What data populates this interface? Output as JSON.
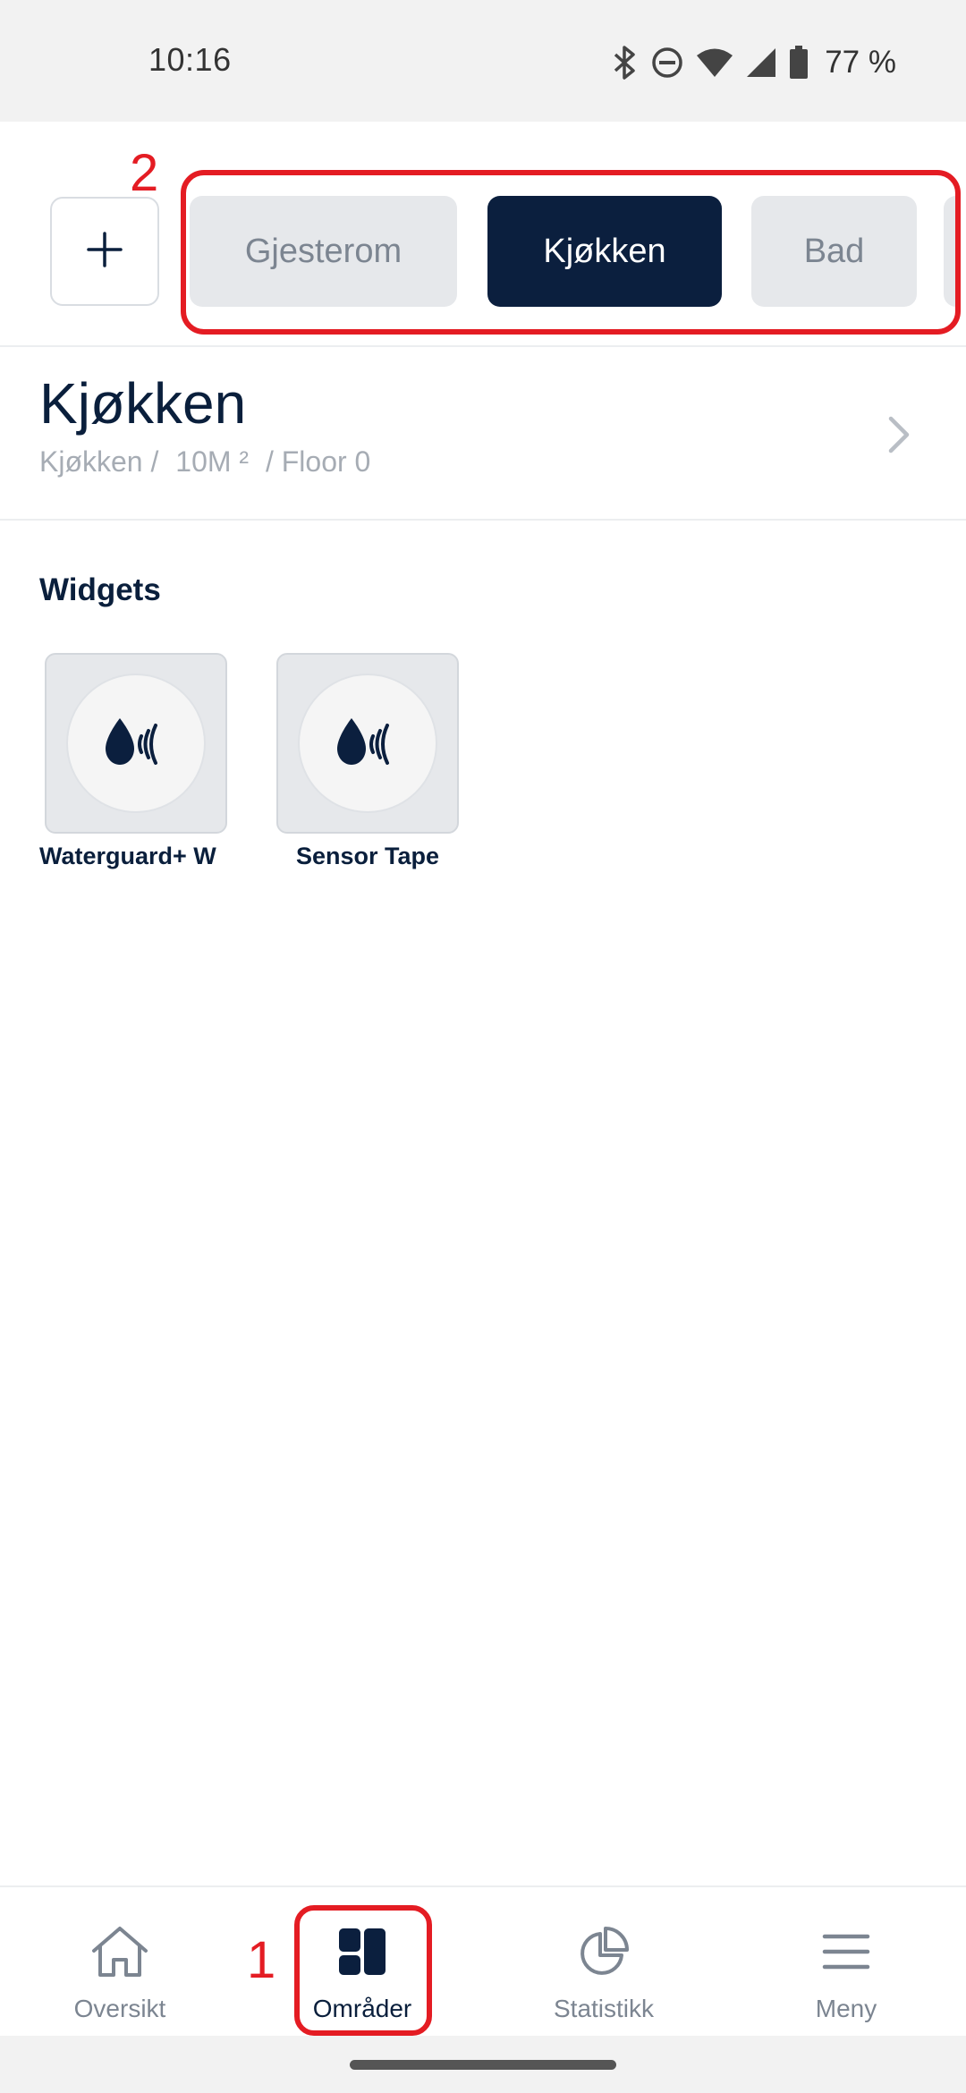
{
  "status_bar": {
    "time": "10:16",
    "battery": "77 %",
    "icons": [
      "bluetooth-icon",
      "do-not-disturb-icon",
      "wifi-icon",
      "cell-signal-icon",
      "battery-icon"
    ]
  },
  "room_tabs": {
    "add_icon": "plus-icon",
    "annotation": "2",
    "tabs": [
      {
        "label": "Gjesterom",
        "active": false
      },
      {
        "label": "Kjøkken",
        "active": true
      },
      {
        "label": "Bad",
        "active": false
      }
    ]
  },
  "room": {
    "title": "Kjøkken",
    "breadcrumb": {
      "name": "Kjøkken /",
      "area": "10M ²",
      "floor": "/ Floor 0"
    }
  },
  "widgets": {
    "heading": "Widgets",
    "items": [
      {
        "label": "Waterguard+ W",
        "icon": "water-sensor-icon"
      },
      {
        "label": "Sensor Tape",
        "icon": "water-sensor-icon"
      }
    ]
  },
  "bottom_nav": {
    "annotation": "1",
    "items": [
      {
        "label": "Oversikt",
        "icon": "home-icon",
        "active": false
      },
      {
        "label": "Områder",
        "icon": "areas-grid-icon",
        "active": true
      },
      {
        "label": "Statistikk",
        "icon": "pie-chart-icon",
        "active": false
      },
      {
        "label": "Meny",
        "icon": "menu-icon",
        "active": false
      }
    ]
  },
  "colors": {
    "primary": "#0b1f3e",
    "inactive_tab_bg": "#e6e8eb",
    "annotation_red": "#e41c23"
  }
}
